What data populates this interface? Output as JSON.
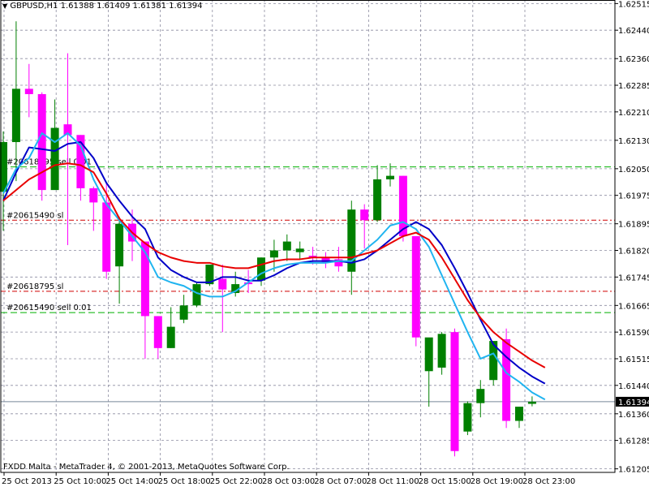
{
  "header": {
    "symbol": "GBPUSD,H1",
    "ohlc": "1.61388 1.61409 1.61381 1.61394",
    "title_full": "GBPUSD,H1  1.61388 1.61409 1.61381 1.61394"
  },
  "footer": {
    "copyright": "FXDD Malta - MetaTrader 4, © 2001-2013, MetaQuotes Software Corp."
  },
  "colors": {
    "background": "#ffffff",
    "grid": "#8c8ca0",
    "axis_text": "#000000",
    "bull_candle": "#008000",
    "bear_candle": "#ff00ff",
    "doji": "#00ff00",
    "ma_blue": "#0000c8",
    "ma_cyan": "#20b4f0",
    "ma_red": "#e80000",
    "order_sell_line": "#00b000",
    "order_sl_line": "#d00000",
    "bid_line": "#778899",
    "price_box_bg": "#000000",
    "price_box_text": "#ffffff"
  },
  "chart_data": {
    "type": "candlestick",
    "title": "GBPUSD,H1",
    "y_ticks": [
      "1.62515",
      "1.62440",
      "1.62360",
      "1.62285",
      "1.62210",
      "1.62130",
      "1.62050",
      "1.61975",
      "1.61895",
      "1.61820",
      "1.61745",
      "1.61665",
      "1.61590",
      "1.61515",
      "1.61440",
      "1.61360",
      "1.61285",
      "1.61205"
    ],
    "x_ticks": [
      "25 Oct 2013",
      "25 Oct 10:00",
      "25 Oct 14:00",
      "25 Oct 18:00",
      "25 Oct 22:00",
      "28 Oct 03:00",
      "28 Oct 07:00",
      "28 Oct 11:00",
      "28 Oct 15:00",
      "28 Oct 19:00",
      "28 Oct 23:00"
    ],
    "ylim": [
      1.61195,
      1.62525
    ],
    "current_price": "1.61394",
    "current_price_value": 1.61394,
    "candles": [
      {
        "o": 1.61985,
        "h": 1.62155,
        "l": 1.61875,
        "c": 1.62125
      },
      {
        "o": 1.62125,
        "h": 1.62465,
        "l": 1.62015,
        "c": 1.62275
      },
      {
        "o": 1.62275,
        "h": 1.62345,
        "l": 1.62195,
        "c": 1.6226
      },
      {
        "o": 1.6226,
        "h": 1.62265,
        "l": 1.6196,
        "c": 1.6199
      },
      {
        "o": 1.6199,
        "h": 1.62245,
        "l": 1.62,
        "c": 1.62165
      },
      {
        "o": 1.62175,
        "h": 1.62375,
        "l": 1.61835,
        "c": 1.62145
      },
      {
        "o": 1.62145,
        "h": 1.62145,
        "l": 1.6196,
        "c": 1.61995
      },
      {
        "o": 1.61995,
        "h": 1.62,
        "l": 1.61875,
        "c": 1.61955
      },
      {
        "o": 1.61955,
        "h": 1.6201,
        "l": 1.6174,
        "c": 1.6176
      },
      {
        "o": 1.61775,
        "h": 1.61915,
        "l": 1.6167,
        "c": 1.61895
      },
      {
        "o": 1.61895,
        "h": 1.61935,
        "l": 1.6179,
        "c": 1.61845
      },
      {
        "o": 1.61845,
        "h": 1.61845,
        "l": 1.61515,
        "c": 1.61635
      },
      {
        "o": 1.61635,
        "h": 1.61635,
        "l": 1.61515,
        "c": 1.61545
      },
      {
        "o": 1.61545,
        "h": 1.6166,
        "l": 1.61545,
        "c": 1.61605
      },
      {
        "o": 1.61625,
        "h": 1.61695,
        "l": 1.61615,
        "c": 1.61665
      },
      {
        "o": 1.61665,
        "h": 1.6173,
        "l": 1.6166,
        "c": 1.61725
      },
      {
        "o": 1.61725,
        "h": 1.61755,
        "l": 1.6172,
        "c": 1.6178
      },
      {
        "o": 1.6174,
        "h": 1.6178,
        "l": 1.6159,
        "c": 1.6171
      },
      {
        "o": 1.617,
        "h": 1.6176,
        "l": 1.6169,
        "c": 1.61725
      },
      {
        "o": 1.6173,
        "h": 1.61765,
        "l": 1.617,
        "c": 1.61725
      },
      {
        "o": 1.61735,
        "h": 1.618,
        "l": 1.6172,
        "c": 1.618
      },
      {
        "o": 1.618,
        "h": 1.6185,
        "l": 1.6176,
        "c": 1.6182
      },
      {
        "o": 1.6182,
        "h": 1.61865,
        "l": 1.6179,
        "c": 1.61845
      },
      {
        "o": 1.61815,
        "h": 1.61845,
        "l": 1.61795,
        "c": 1.61825
      },
      {
        "o": 1.61805,
        "h": 1.6183,
        "l": 1.6178,
        "c": 1.618
      },
      {
        "o": 1.618,
        "h": 1.61815,
        "l": 1.6177,
        "c": 1.61785
      },
      {
        "o": 1.61795,
        "h": 1.6183,
        "l": 1.6176,
        "c": 1.61775
      },
      {
        "o": 1.6176,
        "h": 1.6196,
        "l": 1.61695,
        "c": 1.61935
      },
      {
        "o": 1.61935,
        "h": 1.6195,
        "l": 1.61825,
        "c": 1.61905
      },
      {
        "o": 1.61905,
        "h": 1.6206,
        "l": 1.619,
        "c": 1.6202
      },
      {
        "o": 1.6202,
        "h": 1.62065,
        "l": 1.62,
        "c": 1.6203
      },
      {
        "o": 1.6203,
        "h": 1.6203,
        "l": 1.61845,
        "c": 1.6186
      },
      {
        "o": 1.6186,
        "h": 1.6186,
        "l": 1.6155,
        "c": 1.61575
      },
      {
        "o": 1.6148,
        "h": 1.61565,
        "l": 1.6138,
        "c": 1.61575
      },
      {
        "o": 1.6149,
        "h": 1.6159,
        "l": 1.6147,
        "c": 1.61585
      },
      {
        "o": 1.6159,
        "h": 1.616,
        "l": 1.6124,
        "c": 1.61255
      },
      {
        "o": 1.6131,
        "h": 1.61395,
        "l": 1.613,
        "c": 1.6139
      },
      {
        "o": 1.6139,
        "h": 1.61455,
        "l": 1.6135,
        "c": 1.6143
      },
      {
        "o": 1.61455,
        "h": 1.6155,
        "l": 1.6144,
        "c": 1.61565
      },
      {
        "o": 1.6157,
        "h": 1.616,
        "l": 1.6132,
        "c": 1.6134
      },
      {
        "o": 1.6134,
        "h": 1.6138,
        "l": 1.6132,
        "c": 1.6138
      },
      {
        "o": 1.61388,
        "h": 1.61409,
        "l": 1.61381,
        "c": 1.61394
      }
    ],
    "series": [
      {
        "name": "",
        "color": "#0000c8",
        "values": [
          1.6196,
          1.6204,
          1.6211,
          1.62105,
          1.621,
          1.6212,
          1.62125,
          1.6208,
          1.6201,
          1.6196,
          1.61915,
          1.6188,
          1.618,
          1.61765,
          1.61745,
          1.6173,
          1.6173,
          1.61745,
          1.61745,
          1.61735,
          1.61735,
          1.6175,
          1.6177,
          1.61785,
          1.6179,
          1.6179,
          1.6179,
          1.61785,
          1.61795,
          1.6182,
          1.6185,
          1.6188,
          1.619,
          1.6188,
          1.61835,
          1.6177,
          1.617,
          1.61625,
          1.61555,
          1.6152,
          1.6149,
          1.61465,
          1.61445
        ]
      },
      {
        "name": "",
        "color": "#20b4f0",
        "values": [
          1.6198,
          1.6205,
          1.6208,
          1.6215,
          1.62125,
          1.6215,
          1.62115,
          1.6202,
          1.6195,
          1.61905,
          1.6186,
          1.61815,
          1.61745,
          1.6173,
          1.6172,
          1.617,
          1.6169,
          1.6169,
          1.61705,
          1.6173,
          1.61755,
          1.6177,
          1.6178,
          1.61785,
          1.61785,
          1.61785,
          1.6179,
          1.6179,
          1.6182,
          1.6185,
          1.6189,
          1.619,
          1.6188,
          1.6183,
          1.6175,
          1.6167,
          1.6159,
          1.61515,
          1.6153,
          1.61475,
          1.6145,
          1.6142,
          1.614
        ]
      },
      {
        "name": "",
        "color": "#e80000",
        "values": [
          1.6196,
          1.6199,
          1.6202,
          1.6204,
          1.6206,
          1.62065,
          1.6206,
          1.6204,
          1.6198,
          1.6191,
          1.6187,
          1.6184,
          1.61815,
          1.618,
          1.6179,
          1.61785,
          1.61785,
          1.61775,
          1.6177,
          1.6177,
          1.6178,
          1.6179,
          1.61795,
          1.61795,
          1.618,
          1.618,
          1.618,
          1.618,
          1.6181,
          1.6182,
          1.6184,
          1.6186,
          1.6187,
          1.6185,
          1.618,
          1.6174,
          1.6168,
          1.6163,
          1.6159,
          1.6156,
          1.61535,
          1.6151,
          1.6149
        ]
      }
    ],
    "order_lines": [
      {
        "label": "#20618795 sell 0.01",
        "price": 1.62055,
        "kind": "sell"
      },
      {
        "label": "#20615490 sl",
        "price": 1.61905,
        "kind": "sl"
      },
      {
        "label": "#20618795 sl",
        "price": 1.61705,
        "kind": "sl"
      },
      {
        "label": "#20615490 sell 0.01",
        "price": 1.61645,
        "kind": "sell"
      }
    ]
  }
}
